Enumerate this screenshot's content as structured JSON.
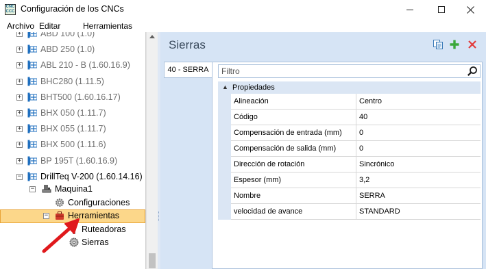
{
  "window": {
    "title": "Configuración de los CNCs",
    "app_icon_text": [
      "CNC",
      "CCC"
    ],
    "minimize_icon": "minimize-icon",
    "maximize_icon": "maximize-icon",
    "close_icon": "close-icon"
  },
  "menu": {
    "items": [
      "Archivo",
      "Editar",
      "Herramientas"
    ]
  },
  "tree": {
    "items": [
      {
        "label": "ABD 100 (1.0)",
        "level": 0,
        "expander": "+",
        "muted": true
      },
      {
        "label": "ABD 250 (1.0)",
        "level": 0,
        "expander": "+",
        "muted": true
      },
      {
        "label": "ABL 210 - B (1.60.16.9)",
        "level": 0,
        "expander": "+",
        "muted": true
      },
      {
        "label": "BHC280 (1.11.5)",
        "level": 0,
        "expander": "+",
        "muted": true
      },
      {
        "label": "BHT500 (1.60.16.17)",
        "level": 0,
        "expander": "+",
        "muted": true
      },
      {
        "label": "BHX 050 (1.11.7)",
        "level": 0,
        "expander": "+",
        "muted": true
      },
      {
        "label": "BHX 055 (1.11.7)",
        "level": 0,
        "expander": "+",
        "muted": true
      },
      {
        "label": "BHX 500 (1.11.6)",
        "level": 0,
        "expander": "+",
        "muted": true
      },
      {
        "label": "BP 195T (1.60.16.9)",
        "level": 0,
        "expander": "+",
        "muted": true
      },
      {
        "label": "DrillTeq V-200 (1.60.14.16)",
        "level": 0,
        "expander": "−",
        "muted": false
      },
      {
        "label": "Maquina1",
        "level": 1,
        "expander": "−",
        "muted": false
      },
      {
        "label": "Configuraciones",
        "level": 2,
        "expander": "",
        "muted": false
      },
      {
        "label": "Herramientas",
        "level": 2,
        "expander": "−",
        "muted": false
      },
      {
        "label": "Ruteadoras",
        "level": 3,
        "expander": "",
        "muted": false
      },
      {
        "label": "Sierras",
        "level": 3,
        "expander": "",
        "muted": false,
        "selected": true
      }
    ]
  },
  "right_pane": {
    "title": "Sierras",
    "tab_label": "40 - SERRA",
    "filter_placeholder": "Filtro",
    "group_label": "Propiedades",
    "properties": [
      {
        "name": "Alineación",
        "value": "Centro"
      },
      {
        "name": "Código",
        "value": "40"
      },
      {
        "name": "Compensación de entrada (mm)",
        "value": "0"
      },
      {
        "name": "Compensación de salida (mm)",
        "value": "0"
      },
      {
        "name": "Dirección de rotación",
        "value": "Sincrónico"
      },
      {
        "name": "Espesor (mm)",
        "value": "3,2"
      },
      {
        "name": "Nombre",
        "value": "SERRA"
      },
      {
        "name": "velocidad de avance",
        "value": "STANDARD"
      }
    ]
  },
  "colors": {
    "selection_fill": "#fcd78a",
    "selection_border": "#e8a335",
    "pane_background": "#d6e4f5",
    "annotation": "#e0191c"
  }
}
